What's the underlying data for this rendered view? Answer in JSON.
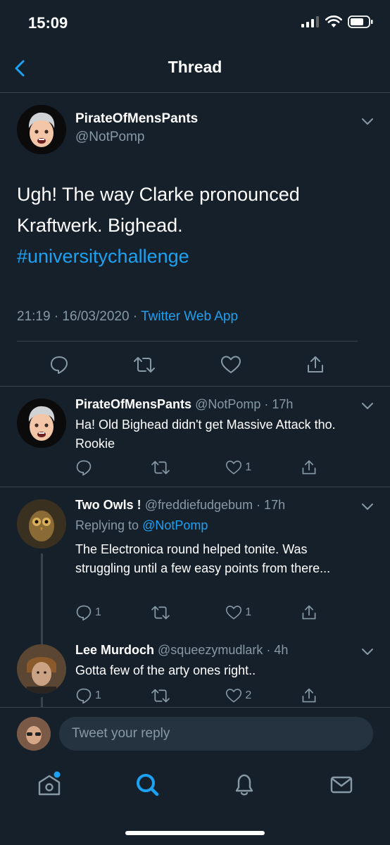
{
  "status_bar": {
    "time": "15:09"
  },
  "header": {
    "title": "Thread"
  },
  "main_tweet": {
    "name": "PirateOfMensPants",
    "handle": "@NotPomp",
    "text": "Ugh! The way Clarke pronounced Kraftwerk.  Bighead.",
    "hashtag": "#universitychallenge",
    "time": "21:19 · 16/03/2020 · ",
    "source": "Twitter Web App"
  },
  "replies": [
    {
      "name": "PirateOfMensPants",
      "handle": "@NotPomp · 17h",
      "text": "Ha! Old Bighead didn't get Massive Attack tho.  Rookie",
      "reply_count": "",
      "retweet_count": "",
      "like_count": "1"
    },
    {
      "name": "Two Owls !",
      "handle": "@freddiefudgebum · 17h",
      "replying_prefix": "Replying to ",
      "replying_to": "@NotPomp",
      "text": "The Electronica round helped tonite. Was struggling until a few easy points from there...",
      "reply_count": "1",
      "retweet_count": "",
      "like_count": "1"
    },
    {
      "name": "Lee Murdoch",
      "handle": "@squeezymudlark · 4h",
      "text": "Gotta few of the arty ones right..",
      "reply_count": "1",
      "retweet_count": "",
      "like_count": "2"
    }
  ],
  "reply_box": {
    "placeholder": "Tweet your reply"
  },
  "tab_bar": {
    "items": [
      "home-icon",
      "search-icon",
      "notifications-icon",
      "messages-icon"
    ],
    "active": "search-icon"
  },
  "colors": {
    "background": "#15202b",
    "accent": "#1da1f2",
    "secondary_text": "#8899a6",
    "divider": "#38444d"
  }
}
